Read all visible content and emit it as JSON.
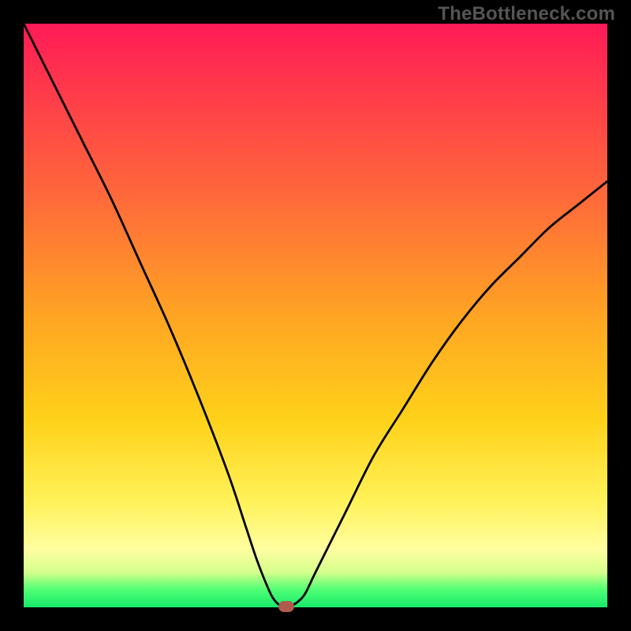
{
  "watermark": "TheBottleneck.com",
  "chart_data": {
    "type": "line",
    "title": "",
    "xlabel": "",
    "ylabel": "",
    "xlim": [
      0,
      100
    ],
    "ylim": [
      0,
      100
    ],
    "grid": false,
    "legend": false,
    "series": [
      {
        "name": "bottleneck-curve",
        "x": [
          0,
          5,
          10,
          15,
          20,
          25,
          30,
          35,
          38,
          40,
          42,
          43,
          44,
          45,
          46,
          48,
          50,
          55,
          60,
          65,
          70,
          75,
          80,
          85,
          90,
          95,
          100
        ],
        "y": [
          100,
          90,
          80,
          70,
          59,
          48,
          36,
          23,
          14,
          8,
          3,
          1.2,
          0.3,
          0.2,
          0.3,
          2,
          6,
          16,
          26,
          34,
          42,
          49,
          55,
          60,
          65,
          69,
          73
        ]
      }
    ],
    "marker": {
      "x": 45,
      "y": 0.2,
      "color": "#b15a4e"
    },
    "background_gradient": {
      "stops": [
        {
          "pos": 0,
          "color": "#ff1a57"
        },
        {
          "pos": 12,
          "color": "#ff3b4a"
        },
        {
          "pos": 30,
          "color": "#ff6a3a"
        },
        {
          "pos": 50,
          "color": "#ffa423"
        },
        {
          "pos": 68,
          "color": "#ffd21a"
        },
        {
          "pos": 82,
          "color": "#fff25a"
        },
        {
          "pos": 90,
          "color": "#fffea0"
        },
        {
          "pos": 94,
          "color": "#d5ff8c"
        },
        {
          "pos": 97,
          "color": "#4fff74"
        },
        {
          "pos": 100,
          "color": "#17e86a"
        }
      ]
    }
  }
}
